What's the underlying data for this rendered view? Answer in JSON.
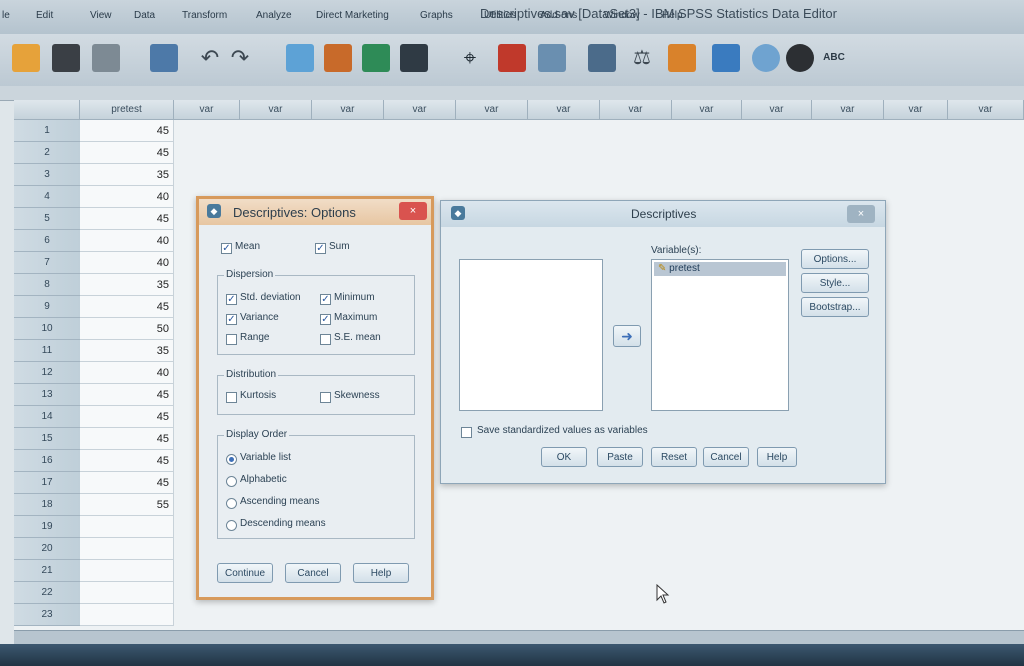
{
  "window": {
    "title": "Descriptives.sav [DataSet3] - IBM SPSS Statistics Data Editor"
  },
  "menu": [
    "le",
    "Edit",
    "View",
    "Data",
    "Transform",
    "Analyze",
    "Direct Marketing",
    "Graphs",
    "Utilities",
    "Add-ons",
    "Window",
    "Help"
  ],
  "grid": {
    "columns": [
      "pretest",
      "var",
      "var",
      "var",
      "var",
      "var",
      "var",
      "var",
      "var",
      "var",
      "var",
      "var",
      "var"
    ],
    "row_numbers": [
      "1",
      "2",
      "3",
      "4",
      "5",
      "6",
      "7",
      "8",
      "9",
      "10",
      "11",
      "12",
      "13",
      "14",
      "15",
      "16",
      "17",
      "18",
      "19",
      "20",
      "21",
      "22",
      "23"
    ],
    "pretest_values": [
      "45",
      "45",
      "35",
      "40",
      "45",
      "40",
      "40",
      "35",
      "45",
      "50",
      "35",
      "40",
      "45",
      "45",
      "45",
      "45",
      "45",
      "55",
      "",
      "",
      "",
      "",
      ""
    ]
  },
  "descriptives": {
    "title": "Descriptives",
    "variables_label": "Variable(s):",
    "selected_variables": [
      "pretest"
    ],
    "save_standardized_label": "Save standardized values as variables",
    "buttons": {
      "options": "Options...",
      "style": "Style...",
      "bootstrap": "Bootstrap...",
      "ok": "OK",
      "paste": "Paste",
      "reset": "Reset",
      "cancel": "Cancel",
      "help": "Help"
    },
    "close": "×"
  },
  "options": {
    "title": "Descriptives: Options",
    "close": "×",
    "mean": "Mean",
    "sum": "Sum",
    "dispersion": {
      "title": "Dispersion",
      "std_dev": "Std. deviation",
      "minimum": "Minimum",
      "variance": "Variance",
      "maximum": "Maximum",
      "range": "Range",
      "se_mean": "S.E. mean"
    },
    "distribution": {
      "title": "Distribution",
      "kurtosis": "Kurtosis",
      "skewness": "Skewness"
    },
    "display_order": {
      "title": "Display Order",
      "variable_list": "Variable list",
      "alphabetic": "Alphabetic",
      "ascending": "Ascending means",
      "descending": "Descending means"
    },
    "buttons": {
      "continue": "Continue",
      "cancel": "Cancel",
      "help": "Help"
    },
    "checked": {
      "mean": true,
      "sum": true,
      "std_dev": true,
      "minimum": true,
      "variance": true,
      "maximum": true,
      "range": false,
      "se_mean": false,
      "kurtosis": false,
      "skewness": false
    },
    "selected_order": "variable_list"
  },
  "colors": {
    "options_border": "#d79a5c",
    "close_red": "#d9534f",
    "accent": "#3d6fb8"
  }
}
